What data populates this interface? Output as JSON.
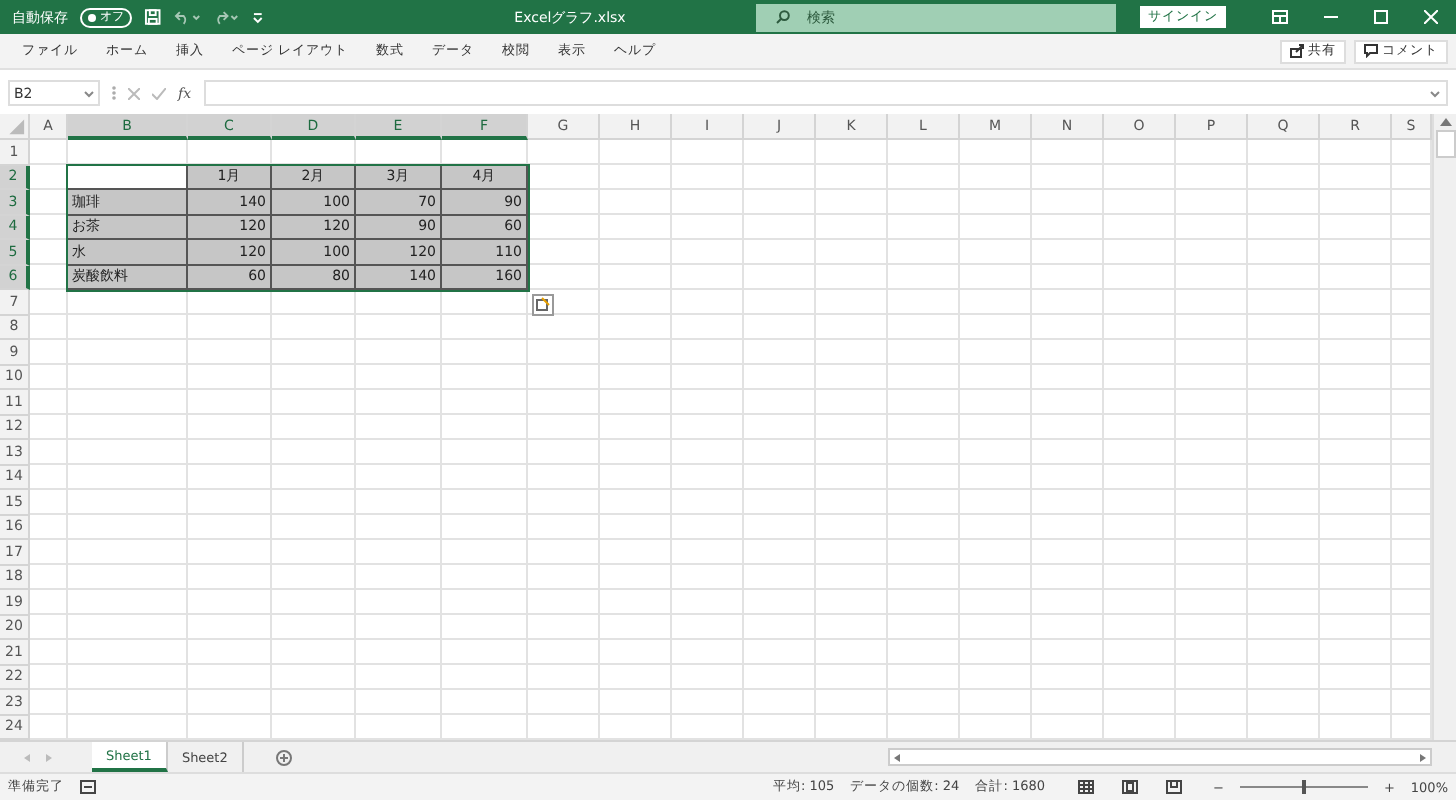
{
  "title_bar": {
    "autosave_label": "自動保存",
    "autosave": {
      "label": "オフ",
      "on": false
    },
    "file_name": "Excelグラフ.xlsx",
    "search": {
      "placeholder": "検索"
    },
    "sign_in": "サインイン"
  },
  "ribbon": {
    "tabs": [
      "ファイル",
      "ホーム",
      "挿入",
      "ページ レイアウト",
      "数式",
      "データ",
      "校閲",
      "表示",
      "ヘルプ"
    ],
    "share": "共有",
    "comments": "コメント"
  },
  "formula_bar": {
    "name_box": "B2",
    "function_button": "fx"
  },
  "sheet": {
    "columns": [
      {
        "label": "A",
        "selected": false
      },
      {
        "label": "B",
        "selected": true
      },
      {
        "label": "C",
        "selected": true
      },
      {
        "label": "D",
        "selected": true
      },
      {
        "label": "E",
        "selected": true
      },
      {
        "label": "F",
        "selected": true
      },
      {
        "label": "G",
        "selected": false
      },
      {
        "label": "H",
        "selected": false
      },
      {
        "label": "I",
        "selected": false
      },
      {
        "label": "J",
        "selected": false
      },
      {
        "label": "K",
        "selected": false
      },
      {
        "label": "L",
        "selected": false
      },
      {
        "label": "M",
        "selected": false
      },
      {
        "label": "N",
        "selected": false
      },
      {
        "label": "O",
        "selected": false
      },
      {
        "label": "P",
        "selected": false
      },
      {
        "label": "Q",
        "selected": false
      },
      {
        "label": "R",
        "selected": false
      },
      {
        "label": "S",
        "selected": false
      }
    ],
    "rows": [
      {
        "label": "1",
        "selected": false
      },
      {
        "label": "2",
        "selected": true
      },
      {
        "label": "3",
        "selected": true
      },
      {
        "label": "4",
        "selected": true
      },
      {
        "label": "5",
        "selected": true
      },
      {
        "label": "6",
        "selected": true
      },
      {
        "label": "7",
        "selected": false
      },
      {
        "label": "8",
        "selected": false
      },
      {
        "label": "9",
        "selected": false
      },
      {
        "label": "10",
        "selected": false
      },
      {
        "label": "11",
        "selected": false
      },
      {
        "label": "12",
        "selected": false
      },
      {
        "label": "13",
        "selected": false
      },
      {
        "label": "14",
        "selected": false
      },
      {
        "label": "15",
        "selected": false
      },
      {
        "label": "16",
        "selected": false
      },
      {
        "label": "17",
        "selected": false
      },
      {
        "label": "18",
        "selected": false
      },
      {
        "label": "19",
        "selected": false
      },
      {
        "label": "20",
        "selected": false
      },
      {
        "label": "21",
        "selected": false
      },
      {
        "label": "22",
        "selected": false
      },
      {
        "label": "23",
        "selected": false
      },
      {
        "label": "24",
        "selected": false
      }
    ],
    "table": {
      "header": [
        "1月",
        "2月",
        "3月",
        "4月"
      ],
      "rows": [
        {
          "label": "珈琲",
          "values": [
            "140",
            "100",
            "70",
            "90"
          ]
        },
        {
          "label": "お茶",
          "values": [
            "120",
            "120",
            "90",
            "60"
          ]
        },
        {
          "label": "水",
          "values": [
            "120",
            "100",
            "120",
            "110"
          ]
        },
        {
          "label": "炭酸飲料",
          "values": [
            "60",
            "80",
            "140",
            "160"
          ]
        }
      ]
    }
  },
  "sheet_tabs": [
    {
      "label": "Sheet1",
      "selected": true
    },
    {
      "label": "Sheet2",
      "selected": false
    }
  ],
  "status_bar": {
    "status": "準備完了",
    "average": "平均: 105",
    "count": "データの個数: 24",
    "sum": "合計: 1680",
    "zoom_out": "−",
    "zoom_in": "+",
    "zoom": {
      "level": 0.5
    },
    "zoom_label": "100%"
  }
}
